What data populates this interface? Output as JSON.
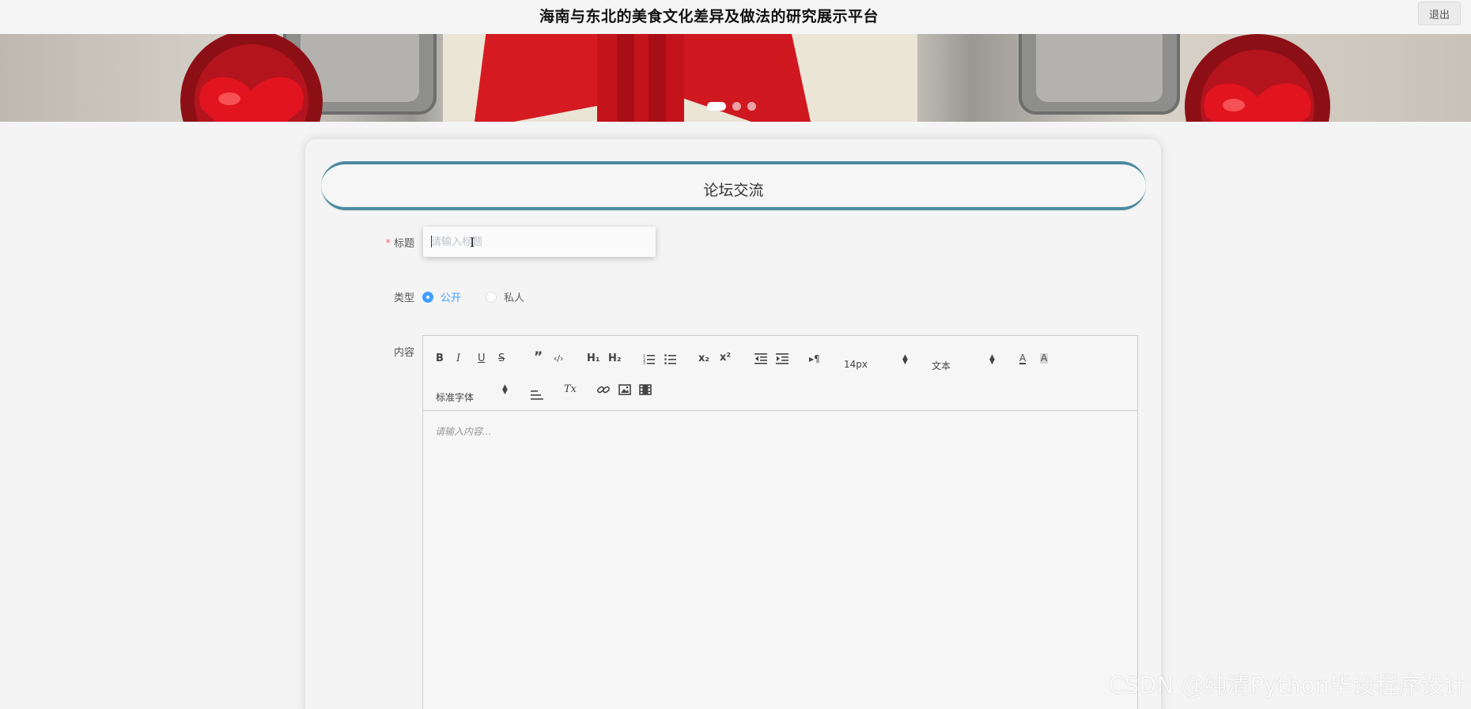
{
  "header": {
    "site_title": "海南与东北的美食文化差异及做法的研究展示平台",
    "logout_label": "退出"
  },
  "banner": {
    "slide_count": 3,
    "active_slide": 1
  },
  "section": {
    "title": "论坛交流"
  },
  "form": {
    "title": {
      "required_mark": "*",
      "label": "标题",
      "placeholder": "请输入标题",
      "value": ""
    },
    "type": {
      "label": "类型",
      "options": [
        "公开",
        "私人"
      ],
      "selected": "公开"
    },
    "content": {
      "label": "内容",
      "placeholder": "请输入内容..."
    }
  },
  "editor_toolbar": {
    "row1": {
      "bold": "B",
      "italic": "I",
      "underline": "U",
      "strike": "S",
      "blockquote": "”",
      "code": "‹/›",
      "h1": "H₁",
      "h2": "H₂",
      "subscript": "x₂",
      "superscript": "x²",
      "direction": "▸¶",
      "size_value": "14px",
      "header_value": "文本",
      "text_color": "A",
      "background": "A"
    },
    "row2": {
      "font_value": "标准字体",
      "clean": "Tx"
    }
  },
  "icons": [
    "ordered-list-icon",
    "bullet-list-icon",
    "outdent-icon",
    "indent-icon",
    "align-icon",
    "link-icon",
    "image-icon",
    "video-icon",
    "i-beam-cursor-icon"
  ],
  "watermark": "CSDN @纯清Python毕设程序设计"
}
